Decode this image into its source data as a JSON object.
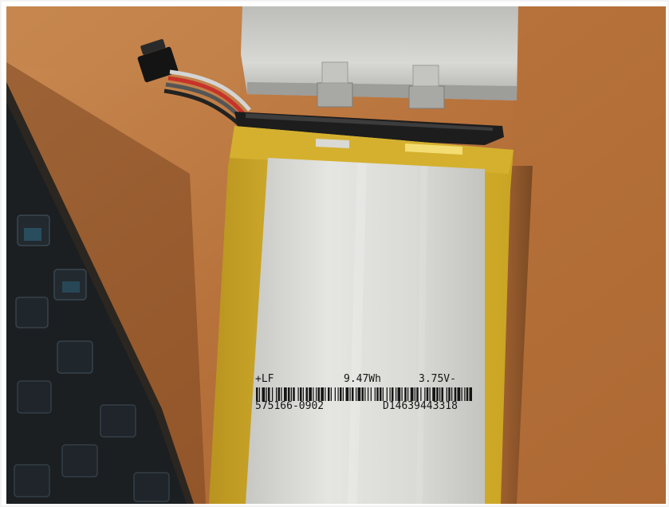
{
  "battery_label": {
    "line1_left": "+LF",
    "line1_center": "9.47Wh",
    "line1_right": "3.75V-",
    "line2_left": "575166-0902",
    "line2_right": "D14639443318"
  },
  "colors": {
    "table_wood": "#b8733c",
    "wood_shadow": "#6d3f1c",
    "battery_label_silver": "#dcdcd8",
    "battery_wrap_yellow": "#e0bb2c",
    "battery_top_silver": "#c9c9c6",
    "keyboard_black": "#1b1f22",
    "ribbon_black": "#1d1d1d"
  }
}
